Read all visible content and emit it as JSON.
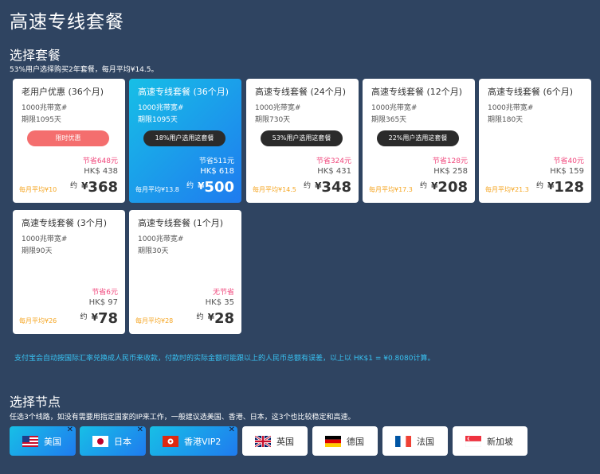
{
  "page_title": "高速专线套餐",
  "plans_section": {
    "title": "选择套餐",
    "subtitle": "53%用户选择购买2年套餐，每月平均¥14.5。"
  },
  "plans": [
    {
      "name": "老用户优惠 (36个月)",
      "bandwidth": "1000兆带宽#",
      "period": "期限1095天",
      "badge": "限时优惠",
      "save": "节省648元",
      "hkd": "HK$ 438",
      "monthly": "每月平均¥10",
      "about": "约",
      "currency": "¥",
      "price": "368"
    },
    {
      "name": "高速专线套餐 (36个月)",
      "bandwidth": "1000兆带宽#",
      "period": "期限1095天",
      "badge": "18%用户选用这套餐",
      "save": "节省511元",
      "hkd": "HK$ 618",
      "monthly": "每月平均¥13.8",
      "about": "约",
      "currency": "¥",
      "price": "500"
    },
    {
      "name": "高速专线套餐 (24个月)",
      "bandwidth": "1000兆带宽#",
      "period": "期限730天",
      "badge": "53%用户选用这套餐",
      "save": "节省324元",
      "hkd": "HK$ 431",
      "monthly": "每月平均¥14.5",
      "about": "约",
      "currency": "¥",
      "price": "348"
    },
    {
      "name": "高速专线套餐 (12个月)",
      "bandwidth": "1000兆带宽#",
      "period": "期限365天",
      "badge": "22%用户选用这套餐",
      "save": "节省128元",
      "hkd": "HK$ 258",
      "monthly": "每月平均¥17.3",
      "about": "约",
      "currency": "¥",
      "price": "208"
    },
    {
      "name": "高速专线套餐 (6个月)",
      "bandwidth": "1000兆带宽#",
      "period": "期限180天",
      "badge": "",
      "save": "节省40元",
      "hkd": "HK$ 159",
      "monthly": "每月平均¥21.3",
      "about": "约",
      "currency": "¥",
      "price": "128"
    },
    {
      "name": "高速专线套餐 (3个月)",
      "bandwidth": "1000兆带宽#",
      "period": "期限90天",
      "badge": "",
      "save": "节省6元",
      "hkd": "HK$ 97",
      "monthly": "每月平均¥26",
      "about": "约",
      "currency": "¥",
      "price": "78"
    },
    {
      "name": "高速专线套餐 (1个月)",
      "bandwidth": "1000兆带宽#",
      "period": "期限30天",
      "badge": "",
      "save": "无节省",
      "hkd": "HK$ 35",
      "monthly": "每月平均¥28",
      "about": "约",
      "currency": "¥",
      "price": "28"
    }
  ],
  "exchange_note": "支付宝会自动按国际汇率兑换成人民币来收款，付款时的实际金额可能跟以上的人民币总额有误差，以上以 HK$1 = ¥0.8080计算。",
  "nodes_section": {
    "title": "选择节点",
    "subtitle": "任选3个线路，如没有需要用指定国家的IP来工作，一般建议选美国、香港、日本，这3个也比较稳定和高速。"
  },
  "nodes": [
    {
      "label": "美国",
      "flag": "us-flag-icon",
      "selected": true
    },
    {
      "label": "日本",
      "flag": "jp-flag-icon",
      "selected": true
    },
    {
      "label": "香港VIP2",
      "flag": "hk-flag-icon",
      "selected": true
    },
    {
      "label": "英国",
      "flag": "uk-flag-icon",
      "selected": false
    },
    {
      "label": "德国",
      "flag": "de-flag-icon",
      "selected": false
    },
    {
      "label": "法国",
      "flag": "fr-flag-icon",
      "selected": false
    },
    {
      "label": "新加坡",
      "flag": "sg-flag-icon",
      "selected": false
    }
  ],
  "close_glyph": "✕",
  "colors": {
    "background": "#2f4461",
    "accent_start": "#17bfe6",
    "accent_end": "#1f7bef",
    "save": "#f0457b",
    "monthly": "#f5a623",
    "note": "#38c2f2",
    "promo": "#f46e6e"
  }
}
